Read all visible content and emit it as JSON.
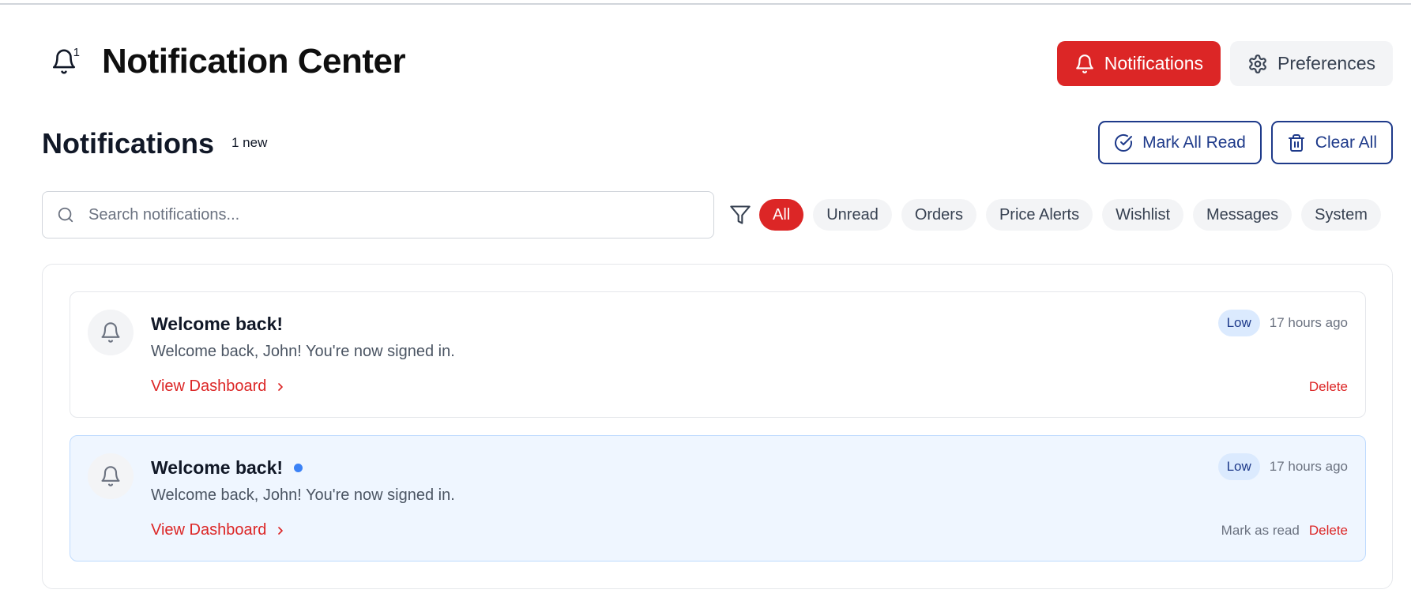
{
  "header": {
    "title": "Notification Center",
    "bell_count": "1",
    "nav": {
      "notifications_label": "Notifications",
      "preferences_label": "Preferences"
    }
  },
  "section": {
    "title": "Notifications",
    "new_badge": "1 new",
    "mark_all_read_label": "Mark All Read",
    "clear_all_label": "Clear All"
  },
  "search": {
    "placeholder": "Search notifications...",
    "value": ""
  },
  "filters": [
    {
      "label": "All",
      "active": true
    },
    {
      "label": "Unread",
      "active": false
    },
    {
      "label": "Orders",
      "active": false
    },
    {
      "label": "Price Alerts",
      "active": false
    },
    {
      "label": "Wishlist",
      "active": false
    },
    {
      "label": "Messages",
      "active": false
    },
    {
      "label": "System",
      "active": false
    }
  ],
  "notifications": [
    {
      "title": "Welcome back!",
      "message": "Welcome back, John! You're now signed in.",
      "link_label": "View Dashboard",
      "priority": "Low",
      "time": "17 hours ago",
      "unread": false,
      "delete_label": "Delete"
    },
    {
      "title": "Welcome back!",
      "message": "Welcome back, John! You're now signed in.",
      "link_label": "View Dashboard",
      "priority": "Low",
      "time": "17 hours ago",
      "unread": true,
      "mark_read_label": "Mark as read",
      "delete_label": "Delete"
    }
  ],
  "icons": {
    "brand": "bell-icon",
    "notifications_button": "bell-icon",
    "preferences_button": "gear-icon",
    "mark_all_read": "check-circle-icon",
    "clear_all": "trash-icon",
    "search": "search-icon",
    "filter": "filter-icon",
    "card": "bell-icon",
    "link": "chevron-right-icon"
  },
  "colors": {
    "accent": "#dc2626",
    "outline_blue": "#1e3a8a",
    "unread_bg": "#eff6ff",
    "unread_dot": "#3b82f6",
    "priority_bg": "#dbeafe"
  }
}
